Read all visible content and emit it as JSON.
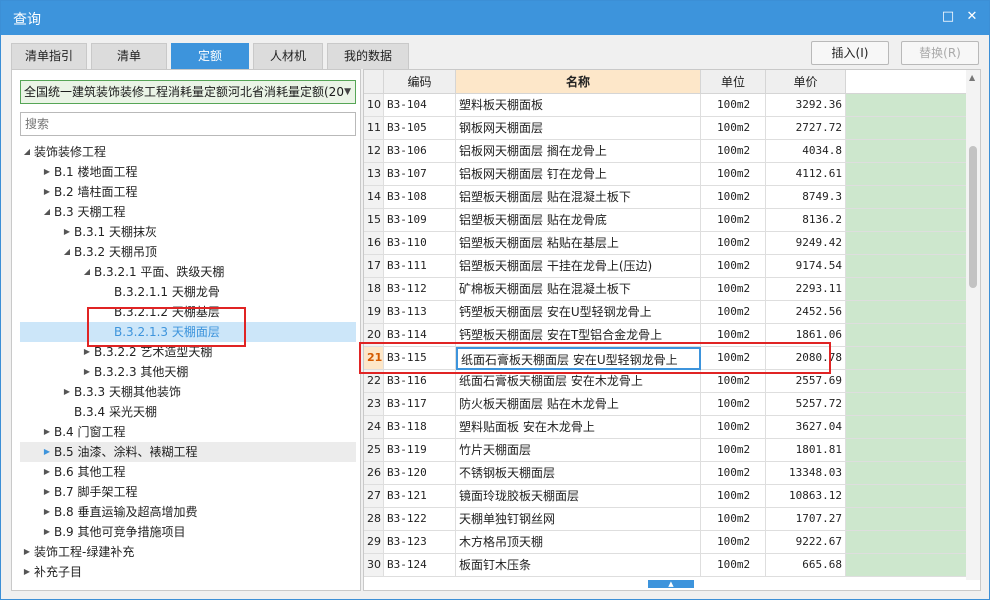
{
  "window": {
    "title": "查询",
    "maximize_icon": "maximize-icon",
    "close_icon": "close-icon"
  },
  "tabs": [
    {
      "label": "清单指引",
      "active": false
    },
    {
      "label": "清单",
      "active": false
    },
    {
      "label": "定额",
      "active": true
    },
    {
      "label": "人材机",
      "active": false
    },
    {
      "label": "我的数据",
      "active": false
    }
  ],
  "actions": {
    "insert_label": "插入(I)",
    "replace_label": "替换(R)"
  },
  "left": {
    "quota_library": "全国统一建筑装饰装修工程消耗量定额河北省消耗量定额(20",
    "search_placeholder": "搜索",
    "tree": [
      {
        "label": "装饰装修工程",
        "expanded": true
      },
      {
        "label": "B.1 楼地面工程",
        "expanded": false
      },
      {
        "label": "B.2 墙柱面工程",
        "expanded": false
      },
      {
        "label": "B.3 天棚工程",
        "expanded": true
      },
      {
        "label": "B.3.1 天棚抹灰",
        "expanded": false
      },
      {
        "label": "B.3.2 天棚吊顶",
        "expanded": true
      },
      {
        "label": "B.3.2.1 平面、跌级天棚",
        "expanded": true
      },
      {
        "label": "B.3.2.1.1 天棚龙骨"
      },
      {
        "label": "B.3.2.1.2 天棚基层"
      },
      {
        "label": "B.3.2.1.3 天棚面层",
        "selected": true
      },
      {
        "label": "B.3.2.2 艺术造型天棚",
        "expanded": false
      },
      {
        "label": "B.3.2.3 其他天棚",
        "expanded": false
      },
      {
        "label": "B.3.3 天棚其他装饰",
        "expanded": false
      },
      {
        "label": "B.3.4 采光天棚"
      },
      {
        "label": "B.4 门窗工程",
        "expanded": false
      },
      {
        "label": "B.5 油漆、涂料、裱糊工程",
        "expanded": false,
        "hover": true
      },
      {
        "label": "B.6 其他工程",
        "expanded": false
      },
      {
        "label": "B.7 脚手架工程",
        "expanded": false
      },
      {
        "label": "B.8 垂直运输及超高增加费",
        "expanded": false
      },
      {
        "label": "B.9 其他可竞争措施项目",
        "expanded": false
      },
      {
        "label": "装饰工程-绿建补充",
        "expanded": false
      },
      {
        "label": "补充子目",
        "expanded": false
      }
    ]
  },
  "table": {
    "columns": {
      "code": "编码",
      "name": "名称",
      "unit": "单位",
      "price": "单价"
    },
    "active_row": "21",
    "rows": [
      {
        "no": "10",
        "code": "B3-104",
        "name": "塑料板天棚面板",
        "unit": "100m2",
        "price": "3292.36"
      },
      {
        "no": "11",
        "code": "B3-105",
        "name": "钢板网天棚面层",
        "unit": "100m2",
        "price": "2727.72"
      },
      {
        "no": "12",
        "code": "B3-106",
        "name": "铝板网天棚面层 搁在龙骨上",
        "unit": "100m2",
        "price": "4034.8"
      },
      {
        "no": "13",
        "code": "B3-107",
        "name": "铝板网天棚面层 钉在龙骨上",
        "unit": "100m2",
        "price": "4112.61"
      },
      {
        "no": "14",
        "code": "B3-108",
        "name": "铝塑板天棚面层 贴在混凝土板下",
        "unit": "100m2",
        "price": "8749.3"
      },
      {
        "no": "15",
        "code": "B3-109",
        "name": "铝塑板天棚面层 贴在龙骨底",
        "unit": "100m2",
        "price": "8136.2"
      },
      {
        "no": "16",
        "code": "B3-110",
        "name": "铝塑板天棚面层 粘贴在基层上",
        "unit": "100m2",
        "price": "9249.42"
      },
      {
        "no": "17",
        "code": "B3-111",
        "name": "铝塑板天棚面层 干挂在龙骨上(压边)",
        "unit": "100m2",
        "price": "9174.54"
      },
      {
        "no": "18",
        "code": "B3-112",
        "name": "矿棉板天棚面层 贴在混凝土板下",
        "unit": "100m2",
        "price": "2293.11"
      },
      {
        "no": "19",
        "code": "B3-113",
        "name": "钙塑板天棚面层 安在U型轻钢龙骨上",
        "unit": "100m2",
        "price": "2452.56"
      },
      {
        "no": "20",
        "code": "B3-114",
        "name": "钙塑板天棚面层 安在T型铝合金龙骨上",
        "unit": "100m2",
        "price": "1861.06"
      },
      {
        "no": "21",
        "code": "B3-115",
        "name": "纸面石膏板天棚面层 安在U型轻钢龙骨上",
        "unit": "100m2",
        "price": "2080.78"
      },
      {
        "no": "22",
        "code": "B3-116",
        "name": "纸面石膏板天棚面层 安在木龙骨上",
        "unit": "100m2",
        "price": "2557.69"
      },
      {
        "no": "23",
        "code": "B3-117",
        "name": "防火板天棚面层 贴在木龙骨上",
        "unit": "100m2",
        "price": "5257.72"
      },
      {
        "no": "24",
        "code": "B3-118",
        "name": "塑料贴面板 安在木龙骨上",
        "unit": "100m2",
        "price": "3627.04"
      },
      {
        "no": "25",
        "code": "B3-119",
        "name": "竹片天棚面层",
        "unit": "100m2",
        "price": "1801.81"
      },
      {
        "no": "26",
        "code": "B3-120",
        "name": "不锈钢板天棚面层",
        "unit": "100m2",
        "price": "13348.03"
      },
      {
        "no": "27",
        "code": "B3-121",
        "name": "镜面玲珑胶板天棚面层",
        "unit": "100m2",
        "price": "10863.12"
      },
      {
        "no": "28",
        "code": "B3-122",
        "name": "天棚单独钉钢丝网",
        "unit": "100m2",
        "price": "1707.27"
      },
      {
        "no": "29",
        "code": "B3-123",
        "name": "木方格吊顶天棚",
        "unit": "100m2",
        "price": "9222.67"
      },
      {
        "no": "30",
        "code": "B3-124",
        "name": "板面钉木压条",
        "unit": "100m2",
        "price": "665.68"
      }
    ]
  },
  "colors": {
    "accent": "#3d94dc",
    "library_bg": "#eaf4e6",
    "empty_col_bg": "#cde7cd",
    "name_header_bg": "#fde7c9",
    "highlight_box": "#e02424"
  }
}
